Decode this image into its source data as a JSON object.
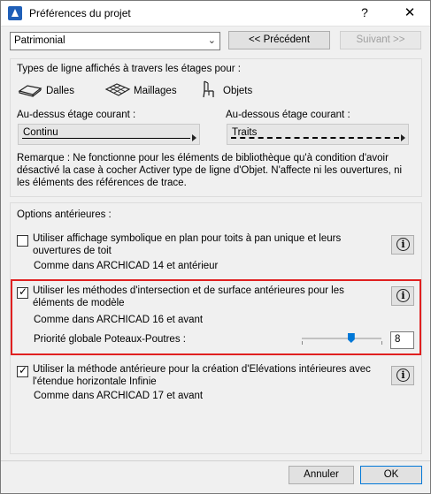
{
  "window": {
    "title": "Préférences du projet",
    "help_glyph": "?",
    "close_glyph": "✕"
  },
  "toolbar": {
    "preset_value": "Patrimonial",
    "prev_label": "<< Précédent",
    "next_label": "Suivant >>"
  },
  "line_types": {
    "heading": "Types de ligne affichés à travers les étages pour :",
    "items": [
      {
        "label": "Dalles",
        "icon": "slab-icon"
      },
      {
        "label": "Maillages",
        "icon": "mesh-icon"
      },
      {
        "label": "Objets",
        "icon": "chair-object-icon"
      }
    ],
    "above_label": "Au-dessus étage courant :",
    "above_value": "Continu",
    "below_label": "Au-dessous étage courant :",
    "below_value": "Traits",
    "remark": "Remarque : Ne fonctionne pour les éléments de bibliothèque qu'à condition d'avoir désactivé la case à cocher Activer type de ligne d'Objet. N'affecte ni les ouvertures, ni les éléments des références de trace."
  },
  "legacy": {
    "heading": "Options antérieures :",
    "options": [
      {
        "label": "Utiliser affichage symbolique en plan pour toits à pan unique et leurs ouvertures de toit",
        "note": "Comme dans ARCHICAD 14 et antérieur",
        "checked": false
      },
      {
        "label": "Utiliser les méthodes d'intersection et de surface antérieures pour les éléments de modèle",
        "note": "Comme dans ARCHICAD 16 et avant",
        "checked": true
      },
      {
        "label": "Utiliser la méthode antérieure pour la création d'Elévations intérieures avec l'étendue horizontale Infinie",
        "note": "Comme dans ARCHICAD 17 et avant",
        "checked": true
      }
    ],
    "priority_label": "Priorité globale Poteaux-Poutres :",
    "priority_value": "8",
    "priority_slider_fraction": 0.62
  },
  "footer": {
    "cancel_label": "Annuler",
    "ok_label": "OK"
  },
  "colors": {
    "highlight": "#e02020",
    "accent": "#0078d7"
  }
}
